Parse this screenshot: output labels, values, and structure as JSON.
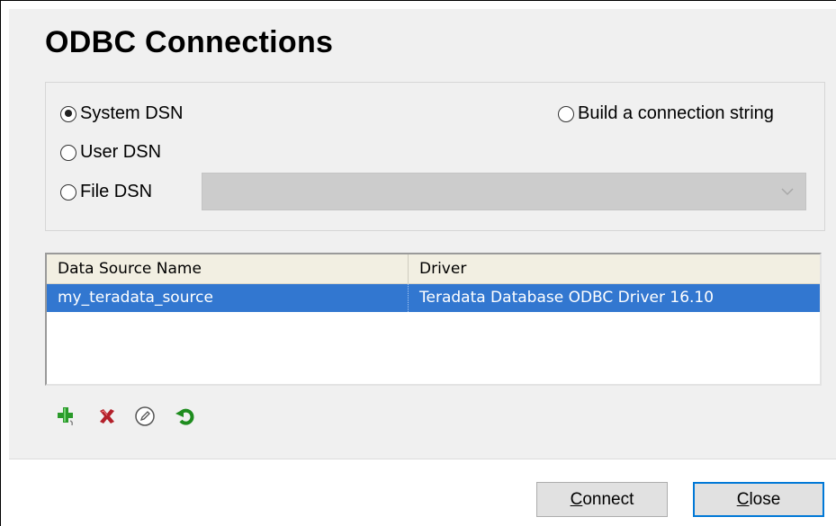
{
  "title": "ODBC Connections",
  "dsn_options": {
    "system_dsn": "System DSN",
    "user_dsn": "User DSN",
    "file_dsn": "File DSN",
    "build_connection_string": "Build a connection string",
    "selected": "system_dsn"
  },
  "file_dsn_combo": {
    "value": ""
  },
  "table": {
    "columns": [
      "Data Source Name",
      "Driver"
    ],
    "rows": [
      {
        "name": "my_teradata_source",
        "driver": "Teradata Database ODBC Driver 16.10",
        "selected": true
      }
    ]
  },
  "toolbar": {
    "icons": [
      "add-icon",
      "delete-icon",
      "edit-icon",
      "refresh-icon"
    ],
    "colors": {
      "add": "#2a9a2a",
      "delete": "#b3202a",
      "edit": "#555555",
      "refresh": "#1e8c1e"
    }
  },
  "buttons": {
    "connect_first": "C",
    "connect_rest": "onnect",
    "close_first": "C",
    "close_rest": "lose"
  },
  "colors": {
    "selection": "#3277d0",
    "focus_border": "#0078d7"
  }
}
